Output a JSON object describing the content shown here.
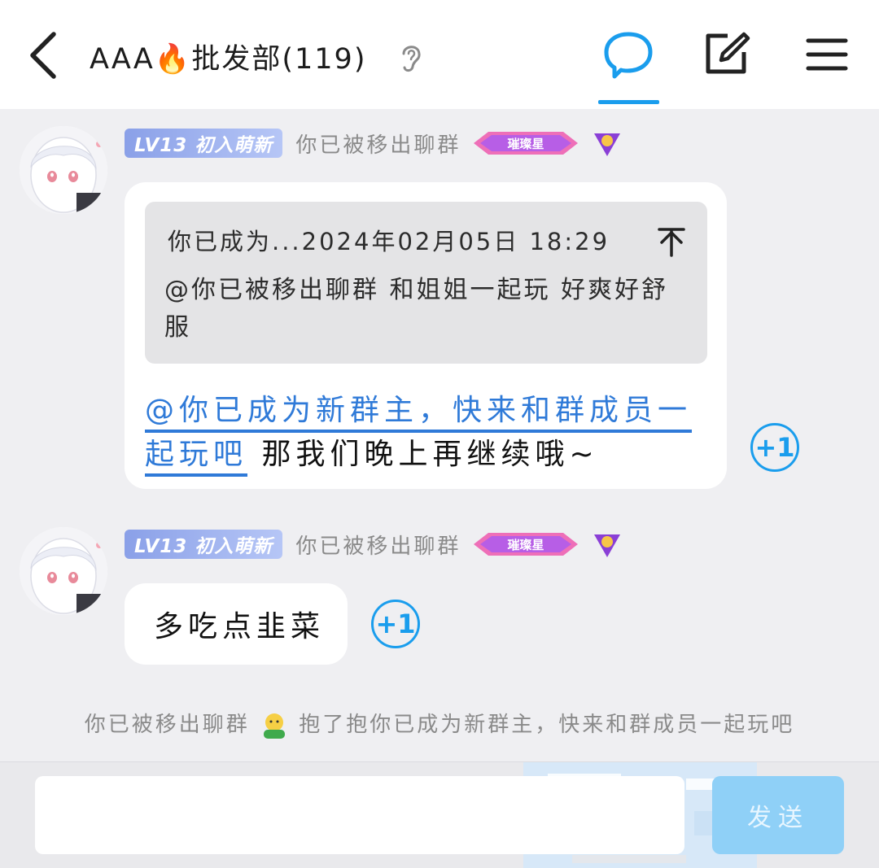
{
  "header": {
    "group_name": "AAA🔥批发部(119)",
    "back_icon": "chevron-left-icon",
    "ear_icon": "ear-icon",
    "chat_icon": "chat-bubble-icon",
    "edit_icon": "edit-icon",
    "menu_icon": "menu-icon",
    "accent_color": "#1a9ded"
  },
  "messages": [
    {
      "level_badge": "LV13 初入萌新",
      "sender": "你已被移出聊群",
      "vip_label": "璀璨星",
      "quote": {
        "header": "你已成为...2024年02月05日 18:29",
        "body": "@你已被移出聊群 和姐姐一起玩 好爽好舒服"
      },
      "mention": "@你已成为新群主，快来和群成员一起玩吧",
      "text": " 那我们晚上再继续哦~",
      "plus_one": "+1"
    },
    {
      "level_badge": "LV13 初入萌新",
      "sender": "你已被移出聊群",
      "vip_label": "璀璨星",
      "text": "多吃点韭菜",
      "plus_one": "+1"
    }
  ],
  "system_message": {
    "actor": "你已被移出聊群",
    "action": "抱了抱",
    "target": "你已成为新群主，快来和群成员一起玩吧"
  },
  "input": {
    "placeholder": "",
    "send_label": "发送"
  }
}
